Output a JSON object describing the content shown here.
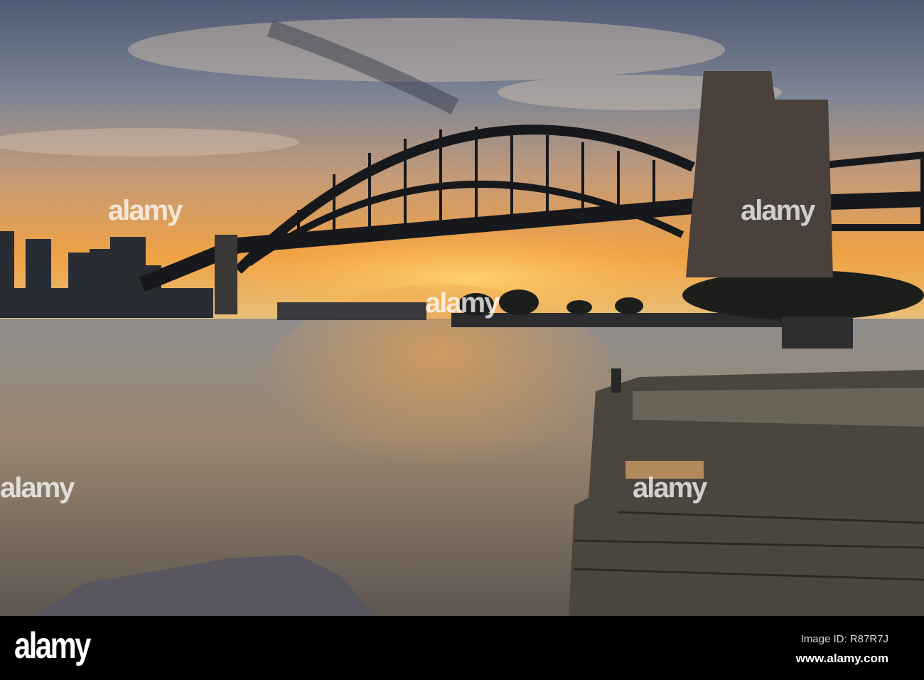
{
  "footer": {
    "logo": "alamy",
    "image_id": "Image ID: R87R7J",
    "url": "www.alamy.com"
  },
  "watermark": "alamy",
  "colors": {
    "sky_top": "#56627a",
    "horizon": "#f2a23c",
    "water": "#8a7a68",
    "silhouette": "#1a1a1e"
  }
}
